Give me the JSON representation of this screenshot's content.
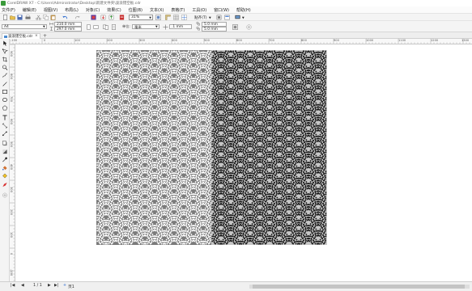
{
  "window": {
    "title": "CorelDRAW X7 - C:\\Users\\Administrator\\Desktop\\新建文件夹\\波浪镂空板.cdr"
  },
  "menubar": {
    "items": [
      {
        "label": "文件(F)"
      },
      {
        "label": "编辑(E)"
      },
      {
        "label": "视图(V)"
      },
      {
        "label": "布局(L)"
      },
      {
        "label": "对象(C)"
      },
      {
        "label": "效果(C)"
      },
      {
        "label": "位图(B)"
      },
      {
        "label": "文本(X)"
      },
      {
        "label": "表格(T)"
      },
      {
        "label": "工具(O)"
      },
      {
        "label": "窗口(W)"
      },
      {
        "label": "帮助(H)"
      }
    ]
  },
  "toolbar": {
    "zoom_value": "31%",
    "snap_label": "贴齐(T)"
  },
  "property_bar": {
    "page_size": "A4",
    "width": "210.0 mm",
    "height": "297.0 mm",
    "units_label": "单位:",
    "units_value": "毫米",
    "nudge": ".1 mm",
    "dup_x": "5.0 mm",
    "dup_y": "5.0 mm"
  },
  "tabs": [
    {
      "label": "波浪镂空板.cdr"
    }
  ],
  "rulers": {
    "h_labels": [
      "-100",
      "0",
      "100",
      "200",
      "300",
      "400",
      "500",
      "600",
      "700",
      "800",
      "900",
      "1000",
      "1100",
      "1200",
      "1300"
    ],
    "v_labels": [
      "900",
      "800",
      "700",
      "600",
      "500",
      "400",
      "300",
      "200",
      "100",
      "0",
      "-100"
    ]
  },
  "artwork": {
    "left_panel_color": "#7b7b7b",
    "left_dot_color": "#ffffff",
    "right_panel_color": "#c7c7c7",
    "right_dot_color": "#1a1a1a"
  },
  "statusbar": {
    "page_indicator": "1 / 1",
    "page_tab": "页1"
  },
  "icons": {
    "colors": {
      "accent": "#3a9a3a",
      "selection": "#2a6ad0"
    }
  }
}
